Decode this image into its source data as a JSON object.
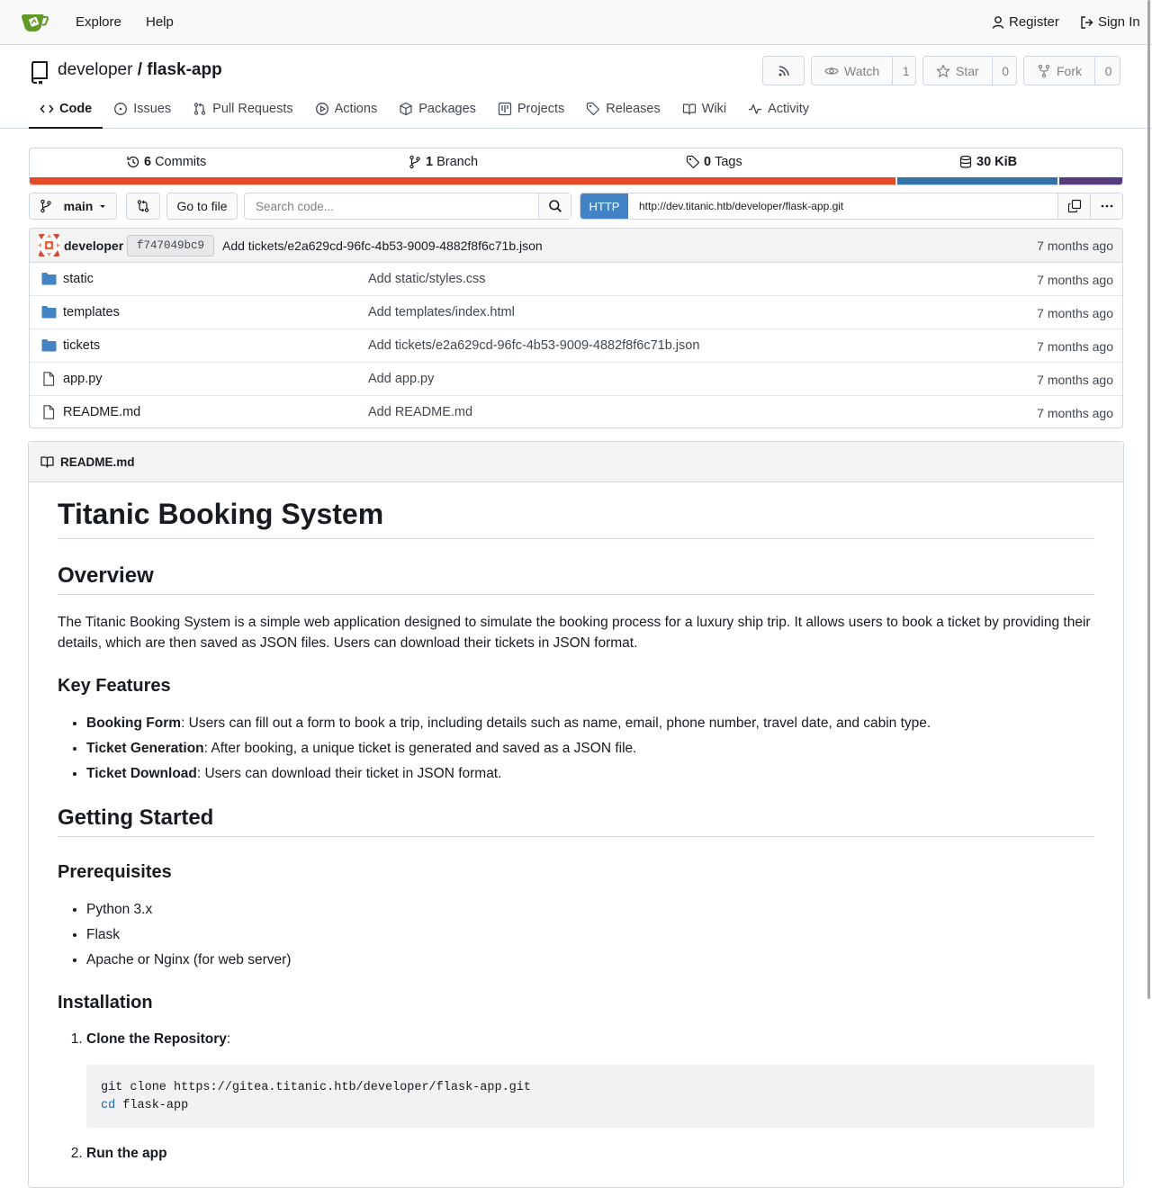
{
  "nav": {
    "explore": "Explore",
    "help": "Help",
    "register": "Register",
    "sign_in": "Sign In"
  },
  "repo": {
    "owner": "developer",
    "separator": "/",
    "name": "flask-app",
    "watch_label": "Watch",
    "watch_count": "1",
    "star_label": "Star",
    "star_count": "0",
    "fork_label": "Fork",
    "fork_count": "0"
  },
  "tabs": [
    {
      "label": "Code",
      "icon": "code-icon"
    },
    {
      "label": "Issues",
      "icon": "issue-icon"
    },
    {
      "label": "Pull Requests",
      "icon": "pull-request-icon"
    },
    {
      "label": "Actions",
      "icon": "play-icon"
    },
    {
      "label": "Packages",
      "icon": "package-icon"
    },
    {
      "label": "Projects",
      "icon": "project-icon"
    },
    {
      "label": "Releases",
      "icon": "tag-icon"
    },
    {
      "label": "Wiki",
      "icon": "book-icon"
    },
    {
      "label": "Activity",
      "icon": "pulse-icon"
    }
  ],
  "stats": {
    "commits_count": "6",
    "commits_label": "Commits",
    "branch_count": "1",
    "branch_label": "Branch",
    "tags_count": "0",
    "tags_label": "Tags",
    "size_value": "30 KiB"
  },
  "language_colors": [
    "#e34c26",
    "#3572a5",
    "#563d7c"
  ],
  "toolbar": {
    "branch": "main",
    "go_to_file": "Go to file",
    "search_placeholder": "Search code...",
    "clone_protocol": "HTTP",
    "clone_url": "http://dev.titanic.htb/developer/flask-app.git"
  },
  "latest_commit": {
    "author": "developer",
    "sha": "f747049bc9",
    "message": "Add tickets/e2a629cd-96fc-4b53-9009-4882f8f6c71b.json",
    "age": "7 months ago"
  },
  "files": [
    {
      "name": "static",
      "type": "folder",
      "message": "Add static/styles.css",
      "age": "7 months ago"
    },
    {
      "name": "templates",
      "type": "folder",
      "message": "Add templates/index.html",
      "age": "7 months ago"
    },
    {
      "name": "tickets",
      "type": "folder",
      "message": "Add tickets/e2a629cd-96fc-4b53-9009-4882f8f6c71b.json",
      "age": "7 months ago"
    },
    {
      "name": "app.py",
      "type": "file",
      "message": "Add app.py",
      "age": "7 months ago"
    },
    {
      "name": "README.md",
      "type": "file",
      "message": "Add README.md",
      "age": "7 months ago"
    }
  ],
  "readme": {
    "filename": "README.md",
    "title": "Titanic Booking System",
    "overview_heading": "Overview",
    "overview_text": "The Titanic Booking System is a simple web application designed to simulate the booking process for a luxury ship trip. It allows users to book a ticket by providing their details, which are then saved as JSON files. Users can download their tickets in JSON format.",
    "features_heading": "Key Features",
    "features": [
      {
        "name": "Booking Form",
        "text": ": Users can fill out a form to book a trip, including details such as name, email, phone number, travel date, and cabin type."
      },
      {
        "name": "Ticket Generation",
        "text": ": After booking, a unique ticket is generated and saved as a JSON file."
      },
      {
        "name": "Ticket Download",
        "text": ": Users can download their ticket in JSON format."
      }
    ],
    "getting_started_heading": "Getting Started",
    "prereq_heading": "Prerequisites",
    "prerequisites": [
      "Python 3.x",
      "Flask",
      "Apache or Nginx (for web server)"
    ],
    "installation_heading": "Installation",
    "step1_label": "Clone the Repository",
    "step1_suffix": ":",
    "code_line1": "git clone https://gitea.titanic.htb/developer/flask-app.git",
    "code_line2_kw": "cd",
    "code_line2_rest": " flask-app",
    "step2_label": "Run the app"
  }
}
